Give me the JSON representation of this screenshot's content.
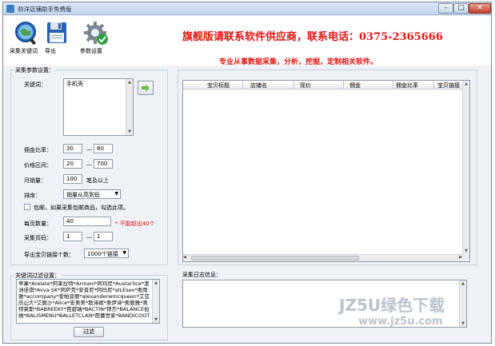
{
  "window": {
    "title": "劲洋店铺助手免费版",
    "min": "–",
    "max": "□",
    "close": "✕"
  },
  "toolbar": {
    "items": [
      {
        "label": "采集关键词",
        "icon": "search-globe-icon"
      },
      {
        "label": "导出",
        "icon": "floppy-disk-icon"
      },
      {
        "label": "参数设置",
        "icon": "gear-icon"
      }
    ]
  },
  "banner": {
    "line1": "旗舰版请联系软件供应商，联系电话：0375-2365666",
    "line2": "专业从事数据采集，分析，挖掘，定制相关软件。",
    "color": "#e01616"
  },
  "settings": {
    "group_title": "采集参数设置：",
    "keyword_label": "关键词：",
    "keyword_value": "手机壳",
    "commission_label": "佣金比率：",
    "commission_min": "30",
    "commission_max": "80",
    "price_label": "价格区间：",
    "price_min": "20",
    "price_max": "700",
    "sales_label": "月销量：",
    "sales_value": "100",
    "sales_suffix": "笔及以上",
    "sort_label": "排序：",
    "sort_value": "销量从高到低",
    "postage_label": "包邮，如果采集包邮商品，勾选此项。",
    "perpage_label": "每页数量：",
    "perpage_value": "40",
    "perpage_hint": "* 不能超出40个",
    "pages_label": "采集页码：",
    "pages_from": "1",
    "pages_to": "1",
    "export_label": "导出宝贝链接个数：",
    "export_value": "1000个链接"
  },
  "filter": {
    "group_title": "关键词过滤设置：",
    "text": "苹果*Arelate*阿莱拉特*Armani*阿玛尼*Austarlice*澳洲佳琪*Avva-SK*阿萨克*安普尼*阿玛尼*alLEsex*奥雨雅*accompany*爱帕普丽*alexanderwmcqueen*艾亚历山大*艾丽沙*Alice*安奥美*散诗妮*奥伊诗*奥丽雅*奥特莱斯*BABREEKY*芭碧瑞*BACTIN*拜杰*BALANCE伯纳*BALISMENU*BALLETCLAN*芭蕾世家*BANDICOOT",
    "button": "过滤"
  },
  "table": {
    "columns": [
      "宝贝标题",
      "店铺名",
      "现价",
      "佣金",
      "佣金比率",
      "宝贝链接"
    ],
    "rows": []
  },
  "log": {
    "title": "采集日志信息："
  },
  "watermark": {
    "line1": "JZ5U绿色下载",
    "line2": "www.jz5u.com"
  }
}
